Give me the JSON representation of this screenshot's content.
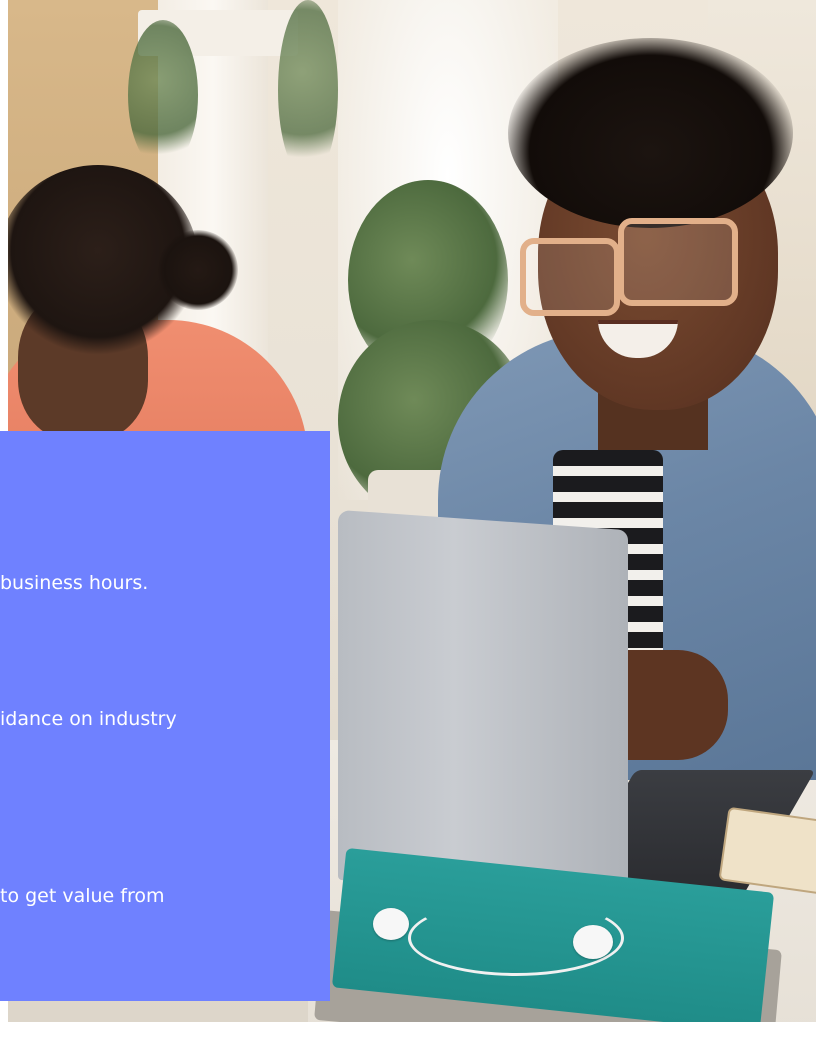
{
  "photo": {
    "description_icon": "photo-image"
  },
  "card": {
    "background_color": "#6f81ff",
    "text_color": "#ffffff",
    "lines": [
      "business hours.",
      "idance on industry",
      "to get value from"
    ]
  }
}
